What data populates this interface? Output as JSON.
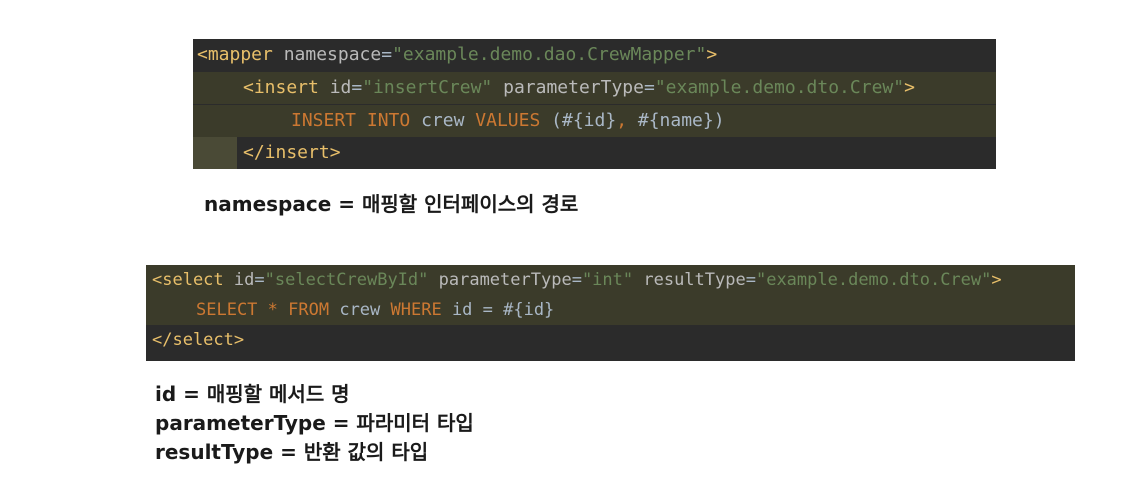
{
  "block1": {
    "line1": {
      "open": "<mapper",
      "attr": " namespace",
      "eq": "=",
      "val": "\"example.demo.dao.CrewMapper\"",
      "close": ">"
    },
    "line2": {
      "open": "<insert",
      "a1": " id",
      "eq1": "=",
      "v1": "\"insertCrew\"",
      "a2": " parameterType",
      "eq2": "=",
      "v2": "\"example.demo.dto.Crew\"",
      "close": ">"
    },
    "line3": {
      "k1": "INSERT",
      "k2": "INTO",
      "plain1": "crew",
      "k3": "VALUES",
      "rest1": "(#{id}",
      "comma": ",",
      "rest2": " #{name})"
    },
    "line4": {
      "close": "</insert>"
    }
  },
  "caption1": "namespace = 매핑할 인터페이스의 경로",
  "block2": {
    "line1": {
      "open": "<select",
      "a1": " id",
      "eq1": "=",
      "v1": "\"selectCrewById\"",
      "a2": " parameterType",
      "eq2": "=",
      "v2": "\"int\"",
      "a3": " resultType",
      "eq3": "=",
      "v3": "\"example.demo.dto.Crew\"",
      "close": ">"
    },
    "line2": {
      "k1": "SELECT",
      "star": " * ",
      "k2": "FROM",
      "plain1": " crew ",
      "k3": "WHERE",
      "rest": " id = #{id}"
    },
    "line3": {
      "close": "</select>"
    }
  },
  "captions2": [
    "id = 매핑할 메서드 명",
    "parameterType = 파라미터 타입",
    "resultType = 반환 값의 타입"
  ]
}
